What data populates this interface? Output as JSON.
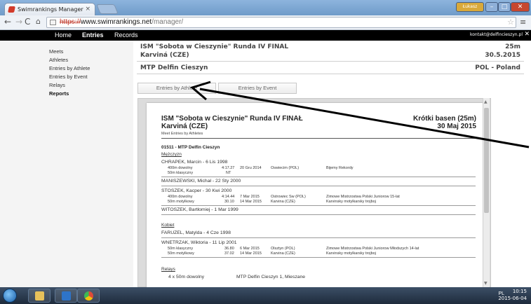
{
  "browser": {
    "tab_title": "Swimrankings Manager",
    "tab_close": "×",
    "url_protocol": "https://",
    "url_host": "www.swimrankings.net",
    "url_path": "/manager/",
    "window_controls": {
      "user": "Łukasz",
      "minimize": "–",
      "maximize": "□",
      "close": "✕"
    },
    "nav": {
      "back": "←",
      "forward": "→",
      "reload": "C",
      "home": "⌂"
    }
  },
  "topnav": {
    "items": [
      "Home",
      "Entries",
      "Records"
    ],
    "active": "Entries",
    "email": "kontakt@delfincieszyn.pl",
    "close": "✕"
  },
  "sidebar": {
    "items": [
      "Meets",
      "Athletes",
      "Entries by Athlete",
      "Entries by Event",
      "Relays",
      "Reports"
    ],
    "active": "Reports"
  },
  "meet": {
    "title": "ISM \"Sobota w Cieszynie\" Runda IV FINAL",
    "location": "Karviná (CZE)",
    "pool": "25m",
    "date": "30.5.2015",
    "club": "MTP Delfin Cieszyn",
    "country": "POL - Poland"
  },
  "buttons": {
    "entries_by_athlete": "Entries by Athlete",
    "entries_by_event": "Entries by Event"
  },
  "report": {
    "title": "ISM \"Sobota w Cieszynie\" Runda IV FINAŁ",
    "location": "Karviná  (CZE)",
    "pool": "Krótki basen (25m)",
    "date": "30 Maj 2015",
    "caption": "Meet Entries by Athletes",
    "club": "01511 - MTP Delfin Cieszyn",
    "men_label": "Mężczyzn",
    "women_label": "Kobiet",
    "relays_label": "Relays",
    "athletes": [
      {
        "name": "CHRAPEK, Marcin  -  6 Lis 1998",
        "events": [
          [
            "400m  dowolny",
            "4:17.27",
            "20 Gru 2014",
            "Oswiecim (POL)",
            "Bijemy Rekordy"
          ],
          [
            "50m  klasyczny",
            "NT",
            "",
            "",
            ""
          ]
        ]
      },
      {
        "name": "MANISZEWSKI, Michał  -  22 Sty 2000",
        "events": []
      },
      {
        "name": "STOSZEK, Kacper  -  30 Kwi 2000",
        "events": [
          [
            "400m  dowolny",
            "4:14.44",
            "7 Mar 2015",
            "Ostrowiec Sw (POL)",
            "Zimowe Mistrzostwa Polski Juniorow 15-lat"
          ],
          [
            "50m  motylkowy",
            "30.10",
            "14 Mar 2015",
            "Karvina (CZE)",
            "Karvinsky motylkarsky trojboj"
          ]
        ]
      },
      {
        "name": "WITOSZEK, Bartłomiej  -  1 Mar 1999",
        "events": []
      }
    ],
    "women": [
      {
        "name": "FARUZEL, Matylda  -  4 Cze 1998",
        "events": []
      },
      {
        "name": "WNETRZAK, Wiktoria  -  11 Lip 2001",
        "events": [
          [
            "50m  klasyczny",
            "36.80",
            "6 Mar 2015",
            "Olsztyn (POL)",
            "Zimowe Mistrzostwa Polski Juniorow Młodszych 14-lat"
          ],
          [
            "50m  motylkowy",
            "37.02",
            "14 Mar 2015",
            "Karvina (CZE)",
            "Karvinsky motylkarsky trojboj"
          ]
        ]
      }
    ],
    "relay": {
      "event": "4 x 50m  dowolny",
      "team": "MTP Delfin Cieszyn 1, Mieszane"
    }
  },
  "taskbar": {
    "tray": "PL",
    "time": "10:15",
    "date": "2015-06-04"
  },
  "colors": {
    "nav_bg": "#000000",
    "sidebar_bg": "#f4f4f4",
    "arrow": "#000000"
  }
}
